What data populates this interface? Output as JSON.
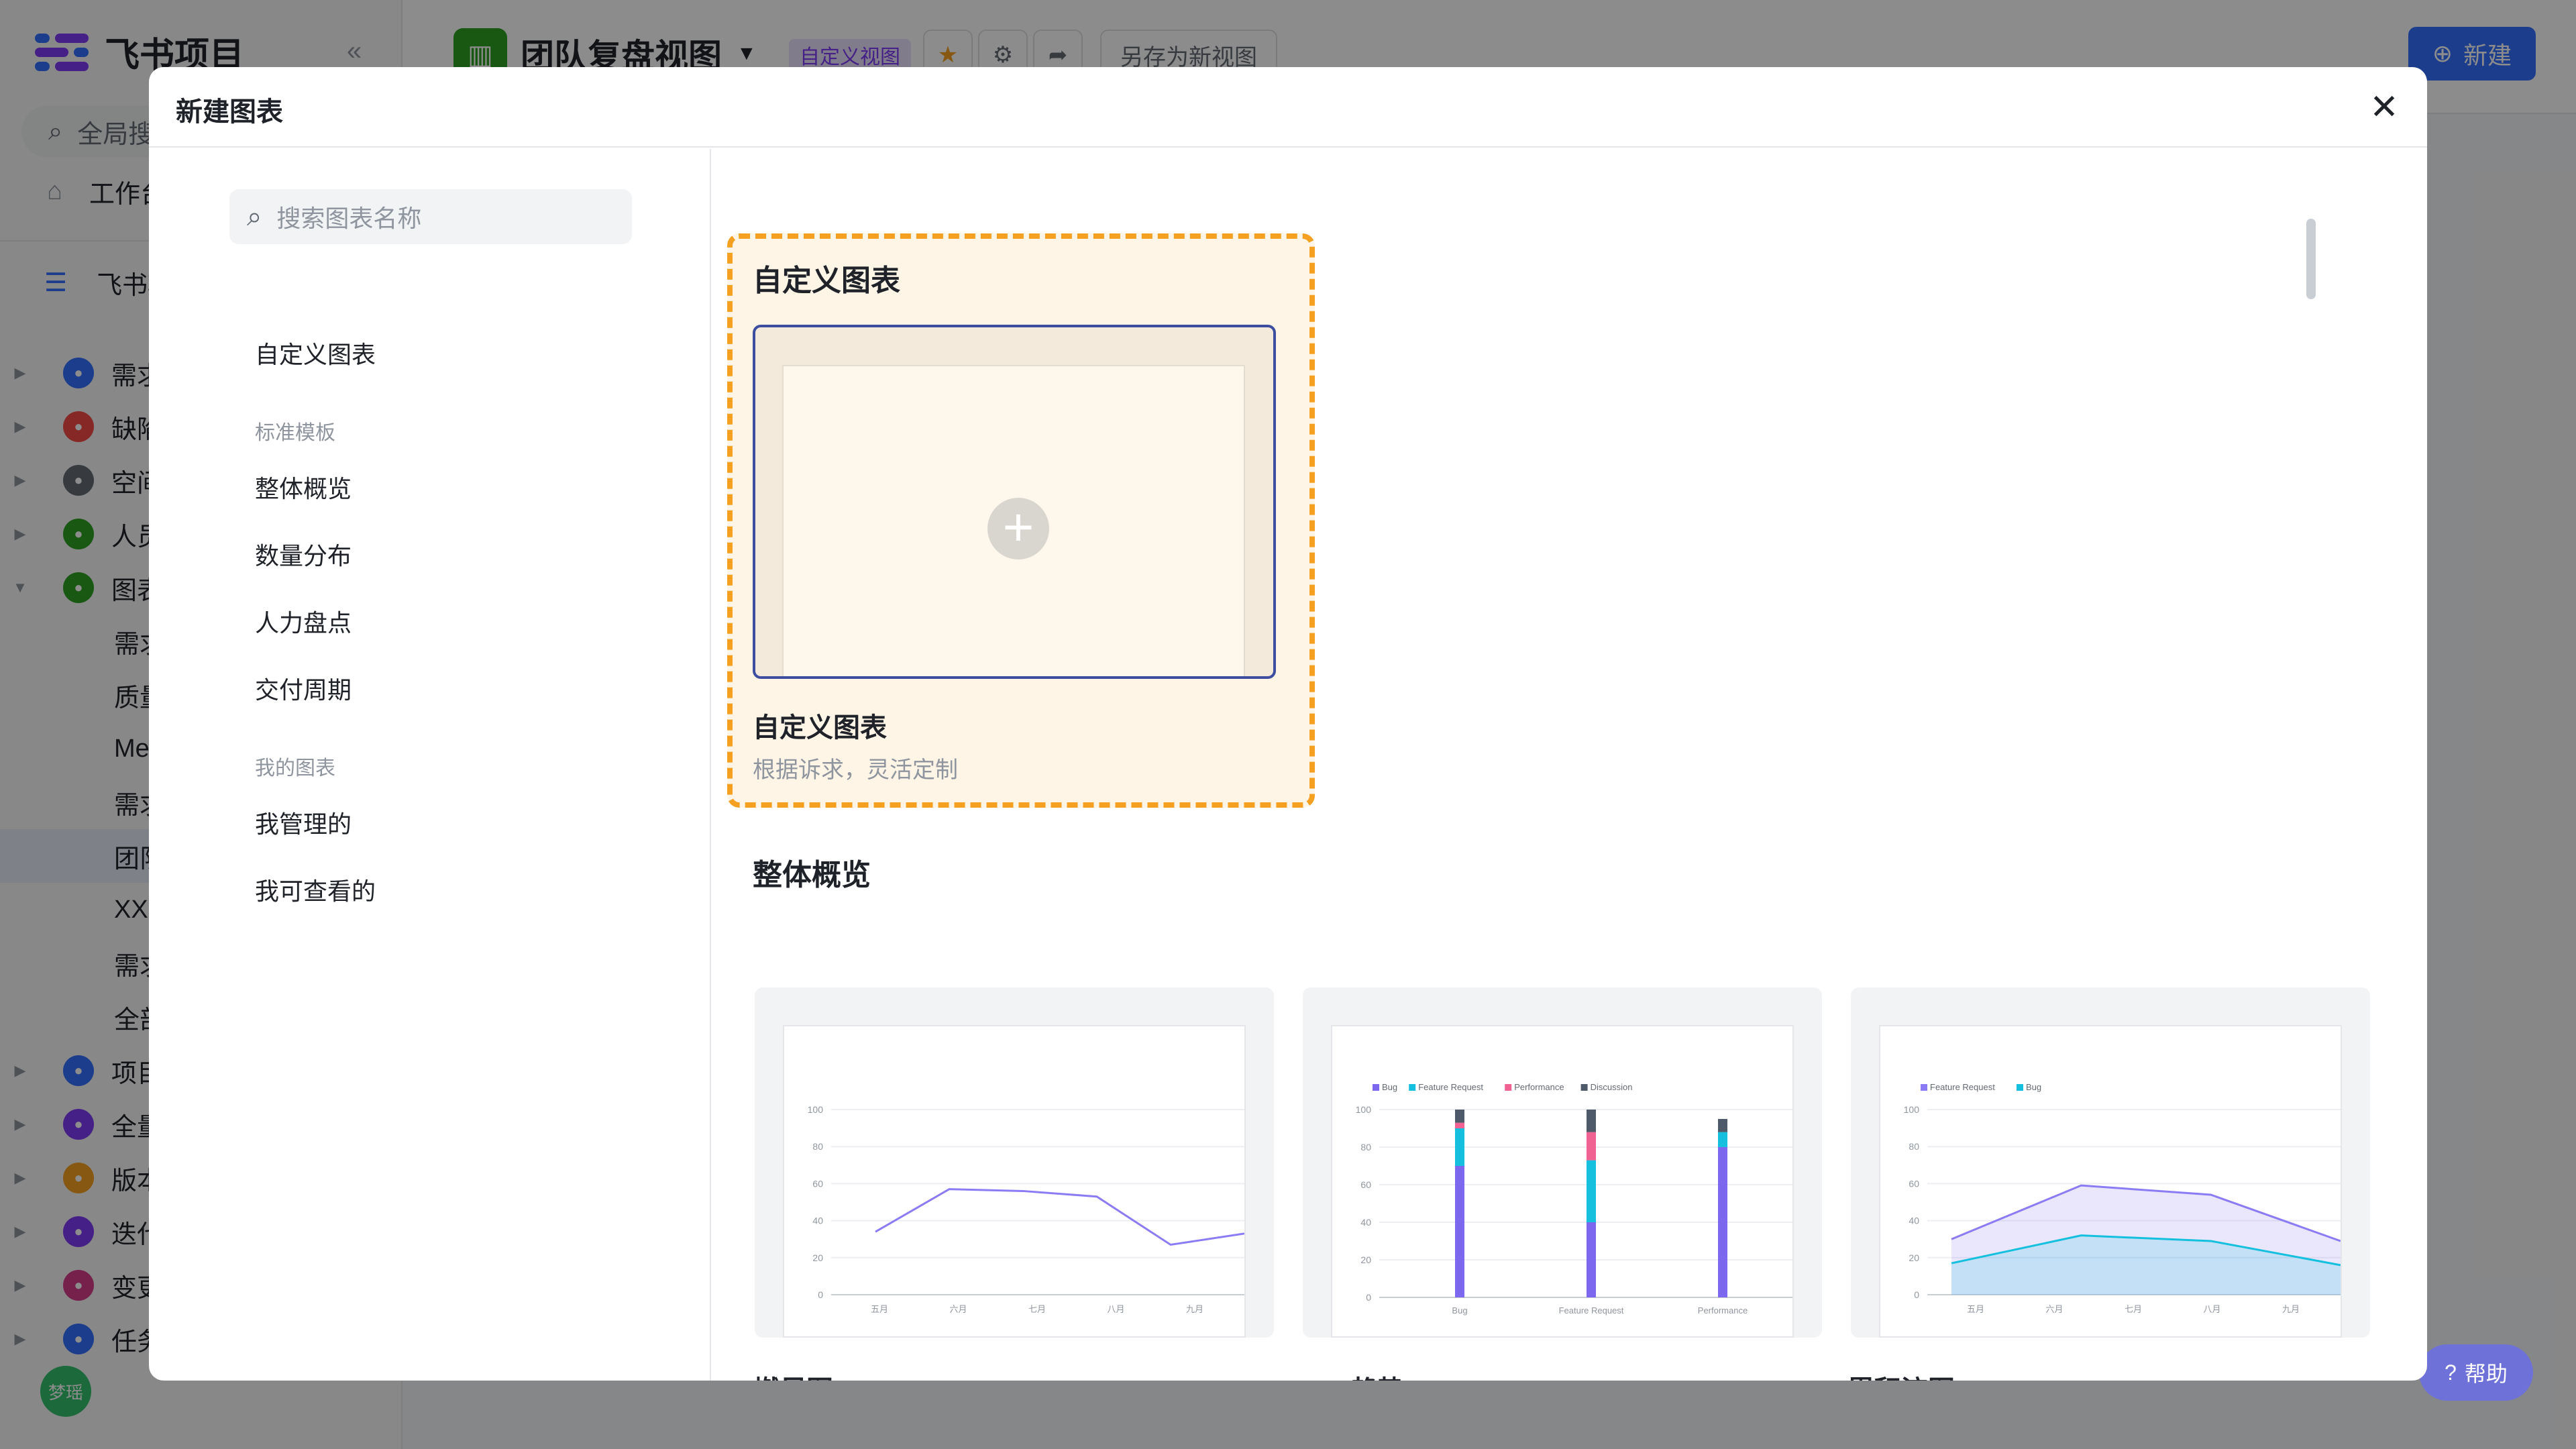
{
  "app": {
    "brand": "飞书项目",
    "search_label": "全局搜索",
    "nav_workbench": "工作台",
    "project_name": "飞书项目",
    "sidebar_items": [
      {
        "label": "需求",
        "color": "#3370ff",
        "expanded": false
      },
      {
        "label": "缺陷",
        "color": "#f54a45",
        "expanded": false
      },
      {
        "label": "空间",
        "color": "#646a73",
        "expanded": false
      },
      {
        "label": "人员",
        "color": "#2ea121",
        "expanded": false
      },
      {
        "label": "图表",
        "color": "#2ea121",
        "expanded": true
      }
    ],
    "sidebar_sub_items": [
      "需求",
      "质量",
      "Me",
      "需求",
      "团队",
      "XX",
      "需求",
      "全部"
    ],
    "sidebar_items_bottom": [
      {
        "label": "项目",
        "color": "#3370ff"
      },
      {
        "label": "全量",
        "color": "#7f3bf5"
      },
      {
        "label": "版本",
        "color": "#f5a021"
      },
      {
        "label": "迭代",
        "color": "#7f3bf5"
      },
      {
        "label": "变更",
        "color": "#d83b8a"
      },
      {
        "label": "任务",
        "color": "#3370ff"
      }
    ],
    "avatar_text": "梦瑶",
    "view_title": "团队复盘视图",
    "view_badge": "自定义视图",
    "save_as_new_view": "另存为新视图",
    "new_button": "新建",
    "help_button": "帮助"
  },
  "modal": {
    "title": "新建图表",
    "search_placeholder": "搜索图表名称",
    "categories": {
      "custom": "自定义图表",
      "group_standard": "标准模板",
      "standard_items": [
        "整体概览",
        "数量分布",
        "人力盘点",
        "交付周期"
      ],
      "group_mine": "我的图表",
      "mine_items": [
        "我管理的",
        "我可查看的"
      ]
    },
    "custom_section": {
      "title": "自定义图表",
      "card_name": "自定义图表",
      "card_desc": "根据诉求，灵活定制"
    },
    "overview_section": {
      "title": "整体概览",
      "cards": [
        "燃尽图",
        "WIP趋势",
        "累积流图"
      ]
    }
  },
  "chart_data": [
    {
      "type": "line",
      "categories": [
        "五月",
        "六月",
        "七月",
        "八月",
        "九月"
      ],
      "series": [
        {
          "values": [
            34,
            57,
            56,
            53,
            27,
            33
          ]
        }
      ],
      "ylim": [
        0,
        100
      ],
      "yticks": [
        0,
        20,
        40,
        60,
        80,
        100
      ],
      "color": "#8b7cf6"
    },
    {
      "type": "bar",
      "stacked": true,
      "categories": [
        "Bug",
        "Feature Request",
        "Performance"
      ],
      "series": [
        {
          "name": "Bug",
          "values": [
            70,
            40,
            80
          ],
          "color": "#7b68ee"
        },
        {
          "name": "Feature Request",
          "values": [
            20,
            33,
            8
          ],
          "color": "#14c0de"
        },
        {
          "name": "Performance",
          "values": [
            3,
            15,
            0
          ],
          "color": "#f06292"
        },
        {
          "name": "Discussion",
          "values": [
            7,
            12,
            7
          ],
          "color": "#4e5969"
        }
      ],
      "ylim": [
        0,
        100
      ],
      "yticks": [
        0,
        20,
        40,
        60,
        80,
        100
      ],
      "legend": "top-left"
    },
    {
      "type": "area",
      "categories": [
        "五月",
        "六月",
        "七月",
        "八月",
        "九月"
      ],
      "series": [
        {
          "name": "Feature Request",
          "values": [
            30,
            59,
            54,
            29
          ],
          "color": "#8b7cf6"
        },
        {
          "name": "Bug",
          "values": [
            17,
            32,
            29,
            16
          ],
          "color": "#14c0de"
        }
      ],
      "ylim": [
        0,
        100
      ],
      "yticks": [
        0,
        20,
        40,
        60,
        80,
        100
      ],
      "legend": "top-left"
    }
  ]
}
